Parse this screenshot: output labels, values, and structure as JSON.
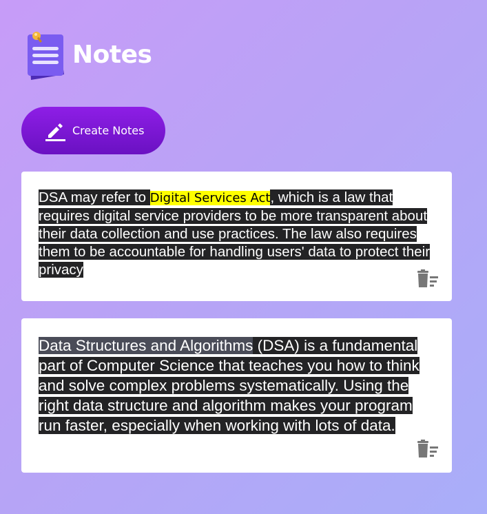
{
  "app": {
    "title": "Notes",
    "logo_icon": "notepad-icon"
  },
  "toolbar": {
    "create_label": "Create Notes",
    "create_icon": "pencil-icon"
  },
  "notes": [
    {
      "text_before": "DSA may refer to ",
      "highlight": "Digital Services Act",
      "text_after": ", which is a law that requires digital service providers to be more transparent about their data collection and use practices. The law also requires them to be accountable for handling users' data to protect their privacy",
      "delete_icon": "trash-icon"
    },
    {
      "text_lead": "Data Structures and Algorithms",
      "text_rest": " (DSA) is a fundamental part of Computer Science that teaches you how to think and solve complex problems systematically. Using the right data structure and algorithm makes your program run faster, especially when working with lots of data.",
      "delete_icon": "trash-icon"
    }
  ],
  "colors": {
    "accent": "#7a16d6",
    "highlight": "#ffff00",
    "selection": "#232325"
  }
}
